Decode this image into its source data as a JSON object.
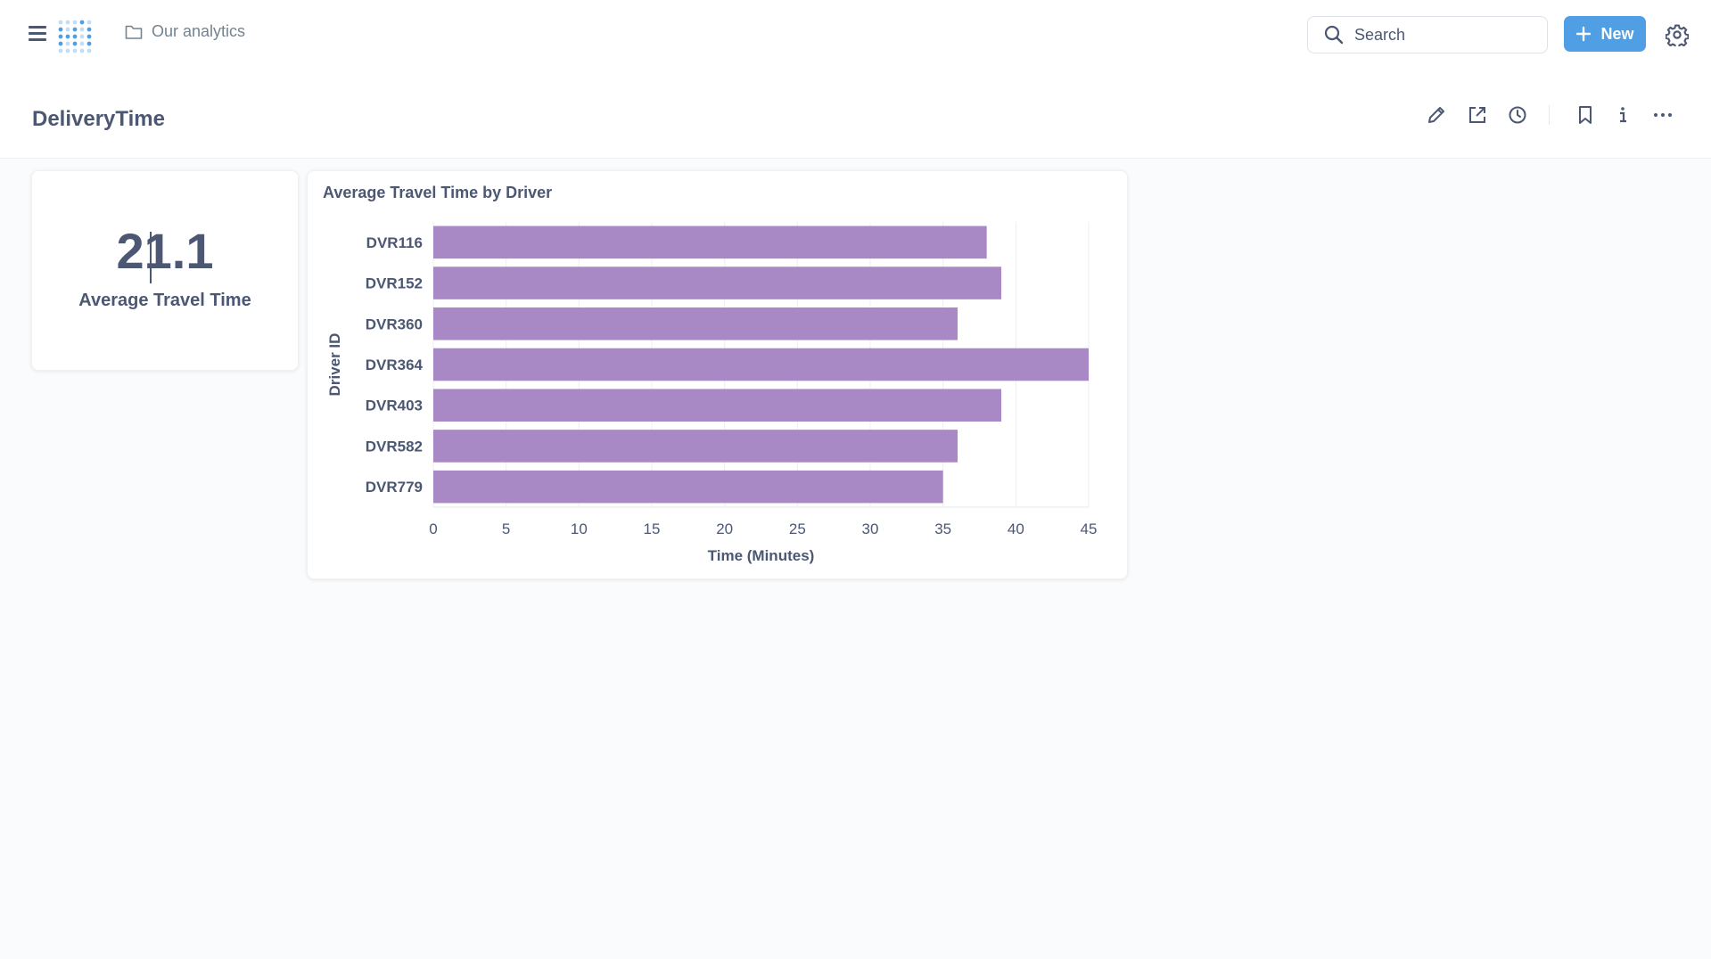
{
  "nav": {
    "breadcrumb": "Our analytics",
    "search_placeholder": "Search",
    "new_label": "New"
  },
  "page": {
    "title": "DeliveryTime"
  },
  "scalar": {
    "value": "21.1",
    "label": "Average Travel Time"
  },
  "chart": {
    "title": "Average Travel Time by Driver"
  },
  "colors": {
    "accent": "#509ee3",
    "bar": "#a989c5"
  },
  "chart_data": {
    "type": "bar",
    "orientation": "horizontal",
    "title": "Average Travel Time by Driver",
    "xlabel": "Time (Minutes)",
    "ylabel": "Driver ID",
    "categories": [
      "DVR116",
      "DVR152",
      "DVR360",
      "DVR364",
      "DVR403",
      "DVR582",
      "DVR779"
    ],
    "values": [
      38,
      39,
      36,
      45,
      39,
      36,
      35
    ],
    "xlim": [
      0,
      45
    ],
    "xticks": [
      0,
      5,
      10,
      15,
      20,
      25,
      30,
      35,
      40,
      45
    ],
    "grid": true,
    "legend": "none"
  }
}
